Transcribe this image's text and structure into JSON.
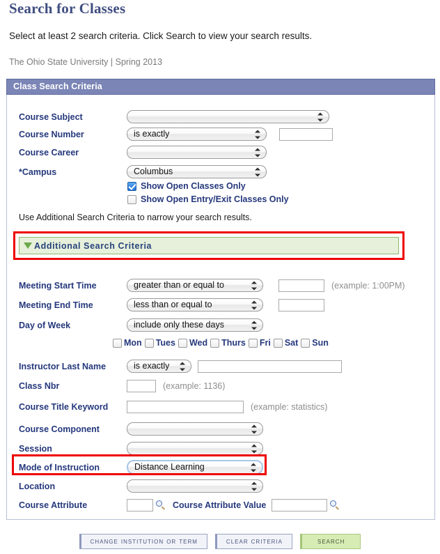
{
  "page": {
    "title": "Search for Classes",
    "instruction": "Select at least 2 search criteria. Click Search to view your search results.",
    "institution_term": "The Ohio State University | Spring 2013"
  },
  "panel": {
    "header": "Class Search Criteria",
    "note": "Use Additional Search Criteria to narrow your search results."
  },
  "basic": {
    "course_subject": {
      "label": "Course Subject",
      "value": ""
    },
    "course_number": {
      "label": "Course Number",
      "operator": "is exactly",
      "value": ""
    },
    "course_career": {
      "label": "Course Career",
      "value": ""
    },
    "campus": {
      "label": "*Campus",
      "value": "Columbus"
    },
    "show_open_classes": {
      "label": "Show Open Classes Only",
      "checked": true
    },
    "show_open_entry_exit": {
      "label": "Show Open Entry/Exit Classes Only",
      "checked": false
    }
  },
  "additional": {
    "toggle_label": "Additional Search Criteria",
    "toggle_icon": "triangle-down-icon",
    "meeting_start_time": {
      "label": "Meeting Start Time",
      "operator": "greater than or equal to",
      "value": "",
      "hint": "(example: 1:00PM)"
    },
    "meeting_end_time": {
      "label": "Meeting End Time",
      "operator": "less than or equal to",
      "value": ""
    },
    "day_of_week": {
      "label": "Day of Week",
      "operator": "include only these days",
      "days": [
        {
          "label": "Mon",
          "checked": false
        },
        {
          "label": "Tues",
          "checked": false
        },
        {
          "label": "Wed",
          "checked": false
        },
        {
          "label": "Thurs",
          "checked": false
        },
        {
          "label": "Fri",
          "checked": false
        },
        {
          "label": "Sat",
          "checked": false
        },
        {
          "label": "Sun",
          "checked": false
        }
      ]
    },
    "instructor_last_name": {
      "label": "Instructor Last Name",
      "operator": "is exactly",
      "value": ""
    },
    "class_nbr": {
      "label": "Class Nbr",
      "value": "",
      "hint": "(example: 1136)"
    },
    "course_title_keyword": {
      "label": "Course Title Keyword",
      "value": "",
      "hint": "(example: statistics)"
    },
    "course_component": {
      "label": "Course Component",
      "value": ""
    },
    "session": {
      "label": "Session",
      "value": ""
    },
    "mode_of_instruction": {
      "label": "Mode of Instruction",
      "value": "Distance Learning"
    },
    "location": {
      "label": "Location",
      "value": ""
    },
    "course_attribute": {
      "label": "Course Attribute",
      "value": "",
      "icon": "magnifier-icon"
    },
    "course_attribute_value": {
      "label": "Course Attribute Value",
      "value": "",
      "icon": "magnifier-icon"
    }
  },
  "buttons": {
    "change_institution": "Change Institution or Term",
    "clear_criteria": "Clear Criteria",
    "search": "Search"
  },
  "colors": {
    "panel_header_bg": "#7b85b6",
    "title_text": "#3f4e80",
    "label_text": "#25387c",
    "green_bar_bg": "#e6f0da",
    "green_bar_border": "#8db974",
    "annotation_red": "#ee0000",
    "search_button_bg": "#d7ecb4"
  }
}
